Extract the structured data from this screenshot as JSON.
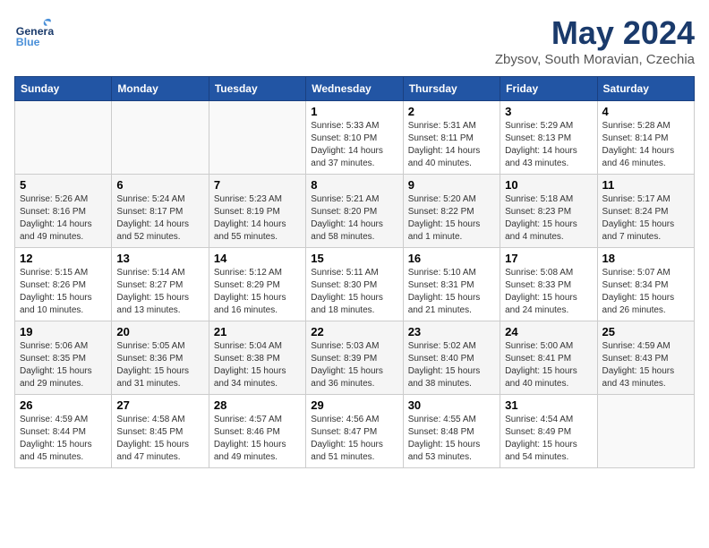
{
  "header": {
    "logo_general": "General",
    "logo_blue": "Blue",
    "month": "May 2024",
    "location": "Zbysov, South Moravian, Czechia"
  },
  "weekdays": [
    "Sunday",
    "Monday",
    "Tuesday",
    "Wednesday",
    "Thursday",
    "Friday",
    "Saturday"
  ],
  "weeks": [
    [
      {
        "day": "",
        "info": ""
      },
      {
        "day": "",
        "info": ""
      },
      {
        "day": "",
        "info": ""
      },
      {
        "day": "1",
        "info": "Sunrise: 5:33 AM\nSunset: 8:10 PM\nDaylight: 14 hours\nand 37 minutes."
      },
      {
        "day": "2",
        "info": "Sunrise: 5:31 AM\nSunset: 8:11 PM\nDaylight: 14 hours\nand 40 minutes."
      },
      {
        "day": "3",
        "info": "Sunrise: 5:29 AM\nSunset: 8:13 PM\nDaylight: 14 hours\nand 43 minutes."
      },
      {
        "day": "4",
        "info": "Sunrise: 5:28 AM\nSunset: 8:14 PM\nDaylight: 14 hours\nand 46 minutes."
      }
    ],
    [
      {
        "day": "5",
        "info": "Sunrise: 5:26 AM\nSunset: 8:16 PM\nDaylight: 14 hours\nand 49 minutes."
      },
      {
        "day": "6",
        "info": "Sunrise: 5:24 AM\nSunset: 8:17 PM\nDaylight: 14 hours\nand 52 minutes."
      },
      {
        "day": "7",
        "info": "Sunrise: 5:23 AM\nSunset: 8:19 PM\nDaylight: 14 hours\nand 55 minutes."
      },
      {
        "day": "8",
        "info": "Sunrise: 5:21 AM\nSunset: 8:20 PM\nDaylight: 14 hours\nand 58 minutes."
      },
      {
        "day": "9",
        "info": "Sunrise: 5:20 AM\nSunset: 8:22 PM\nDaylight: 15 hours\nand 1 minute."
      },
      {
        "day": "10",
        "info": "Sunrise: 5:18 AM\nSunset: 8:23 PM\nDaylight: 15 hours\nand 4 minutes."
      },
      {
        "day": "11",
        "info": "Sunrise: 5:17 AM\nSunset: 8:24 PM\nDaylight: 15 hours\nand 7 minutes."
      }
    ],
    [
      {
        "day": "12",
        "info": "Sunrise: 5:15 AM\nSunset: 8:26 PM\nDaylight: 15 hours\nand 10 minutes."
      },
      {
        "day": "13",
        "info": "Sunrise: 5:14 AM\nSunset: 8:27 PM\nDaylight: 15 hours\nand 13 minutes."
      },
      {
        "day": "14",
        "info": "Sunrise: 5:12 AM\nSunset: 8:29 PM\nDaylight: 15 hours\nand 16 minutes."
      },
      {
        "day": "15",
        "info": "Sunrise: 5:11 AM\nSunset: 8:30 PM\nDaylight: 15 hours\nand 18 minutes."
      },
      {
        "day": "16",
        "info": "Sunrise: 5:10 AM\nSunset: 8:31 PM\nDaylight: 15 hours\nand 21 minutes."
      },
      {
        "day": "17",
        "info": "Sunrise: 5:08 AM\nSunset: 8:33 PM\nDaylight: 15 hours\nand 24 minutes."
      },
      {
        "day": "18",
        "info": "Sunrise: 5:07 AM\nSunset: 8:34 PM\nDaylight: 15 hours\nand 26 minutes."
      }
    ],
    [
      {
        "day": "19",
        "info": "Sunrise: 5:06 AM\nSunset: 8:35 PM\nDaylight: 15 hours\nand 29 minutes."
      },
      {
        "day": "20",
        "info": "Sunrise: 5:05 AM\nSunset: 8:36 PM\nDaylight: 15 hours\nand 31 minutes."
      },
      {
        "day": "21",
        "info": "Sunrise: 5:04 AM\nSunset: 8:38 PM\nDaylight: 15 hours\nand 34 minutes."
      },
      {
        "day": "22",
        "info": "Sunrise: 5:03 AM\nSunset: 8:39 PM\nDaylight: 15 hours\nand 36 minutes."
      },
      {
        "day": "23",
        "info": "Sunrise: 5:02 AM\nSunset: 8:40 PM\nDaylight: 15 hours\nand 38 minutes."
      },
      {
        "day": "24",
        "info": "Sunrise: 5:00 AM\nSunset: 8:41 PM\nDaylight: 15 hours\nand 40 minutes."
      },
      {
        "day": "25",
        "info": "Sunrise: 4:59 AM\nSunset: 8:43 PM\nDaylight: 15 hours\nand 43 minutes."
      }
    ],
    [
      {
        "day": "26",
        "info": "Sunrise: 4:59 AM\nSunset: 8:44 PM\nDaylight: 15 hours\nand 45 minutes."
      },
      {
        "day": "27",
        "info": "Sunrise: 4:58 AM\nSunset: 8:45 PM\nDaylight: 15 hours\nand 47 minutes."
      },
      {
        "day": "28",
        "info": "Sunrise: 4:57 AM\nSunset: 8:46 PM\nDaylight: 15 hours\nand 49 minutes."
      },
      {
        "day": "29",
        "info": "Sunrise: 4:56 AM\nSunset: 8:47 PM\nDaylight: 15 hours\nand 51 minutes."
      },
      {
        "day": "30",
        "info": "Sunrise: 4:55 AM\nSunset: 8:48 PM\nDaylight: 15 hours\nand 53 minutes."
      },
      {
        "day": "31",
        "info": "Sunrise: 4:54 AM\nSunset: 8:49 PM\nDaylight: 15 hours\nand 54 minutes."
      },
      {
        "day": "",
        "info": ""
      }
    ]
  ]
}
